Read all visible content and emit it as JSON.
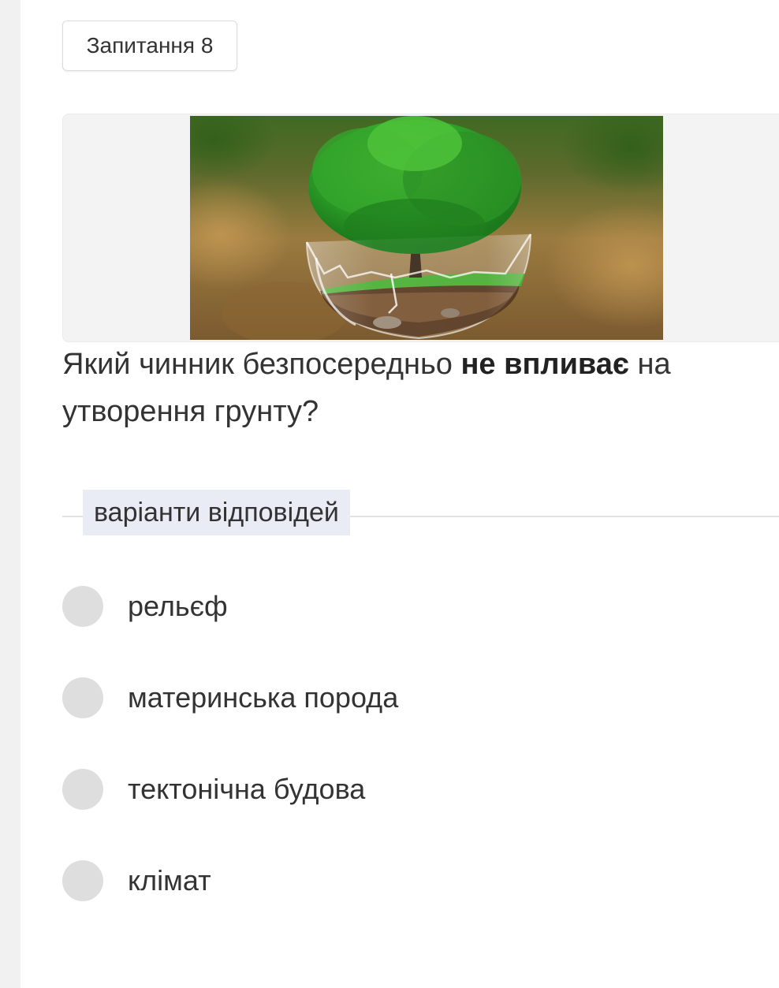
{
  "question": {
    "badge_label": "Запитання 8",
    "text_before": "Який чинник безпосередньо ",
    "text_bold": "не впливає",
    "text_after": " на утворення грунту?",
    "image_icon": "tree-in-glass-globe-image"
  },
  "answers": {
    "section_label": "варіанти відповідей",
    "options": [
      {
        "label": "рельєф",
        "selected": false
      },
      {
        "label": "материнська порода",
        "selected": false
      },
      {
        "label": "тектонічна будова",
        "selected": false
      },
      {
        "label": "клімат",
        "selected": false
      }
    ]
  },
  "colors": {
    "radio_fill": "#dedede",
    "section_label_bg": "#e9ebf5",
    "left_rail": "#f1f1f1"
  }
}
